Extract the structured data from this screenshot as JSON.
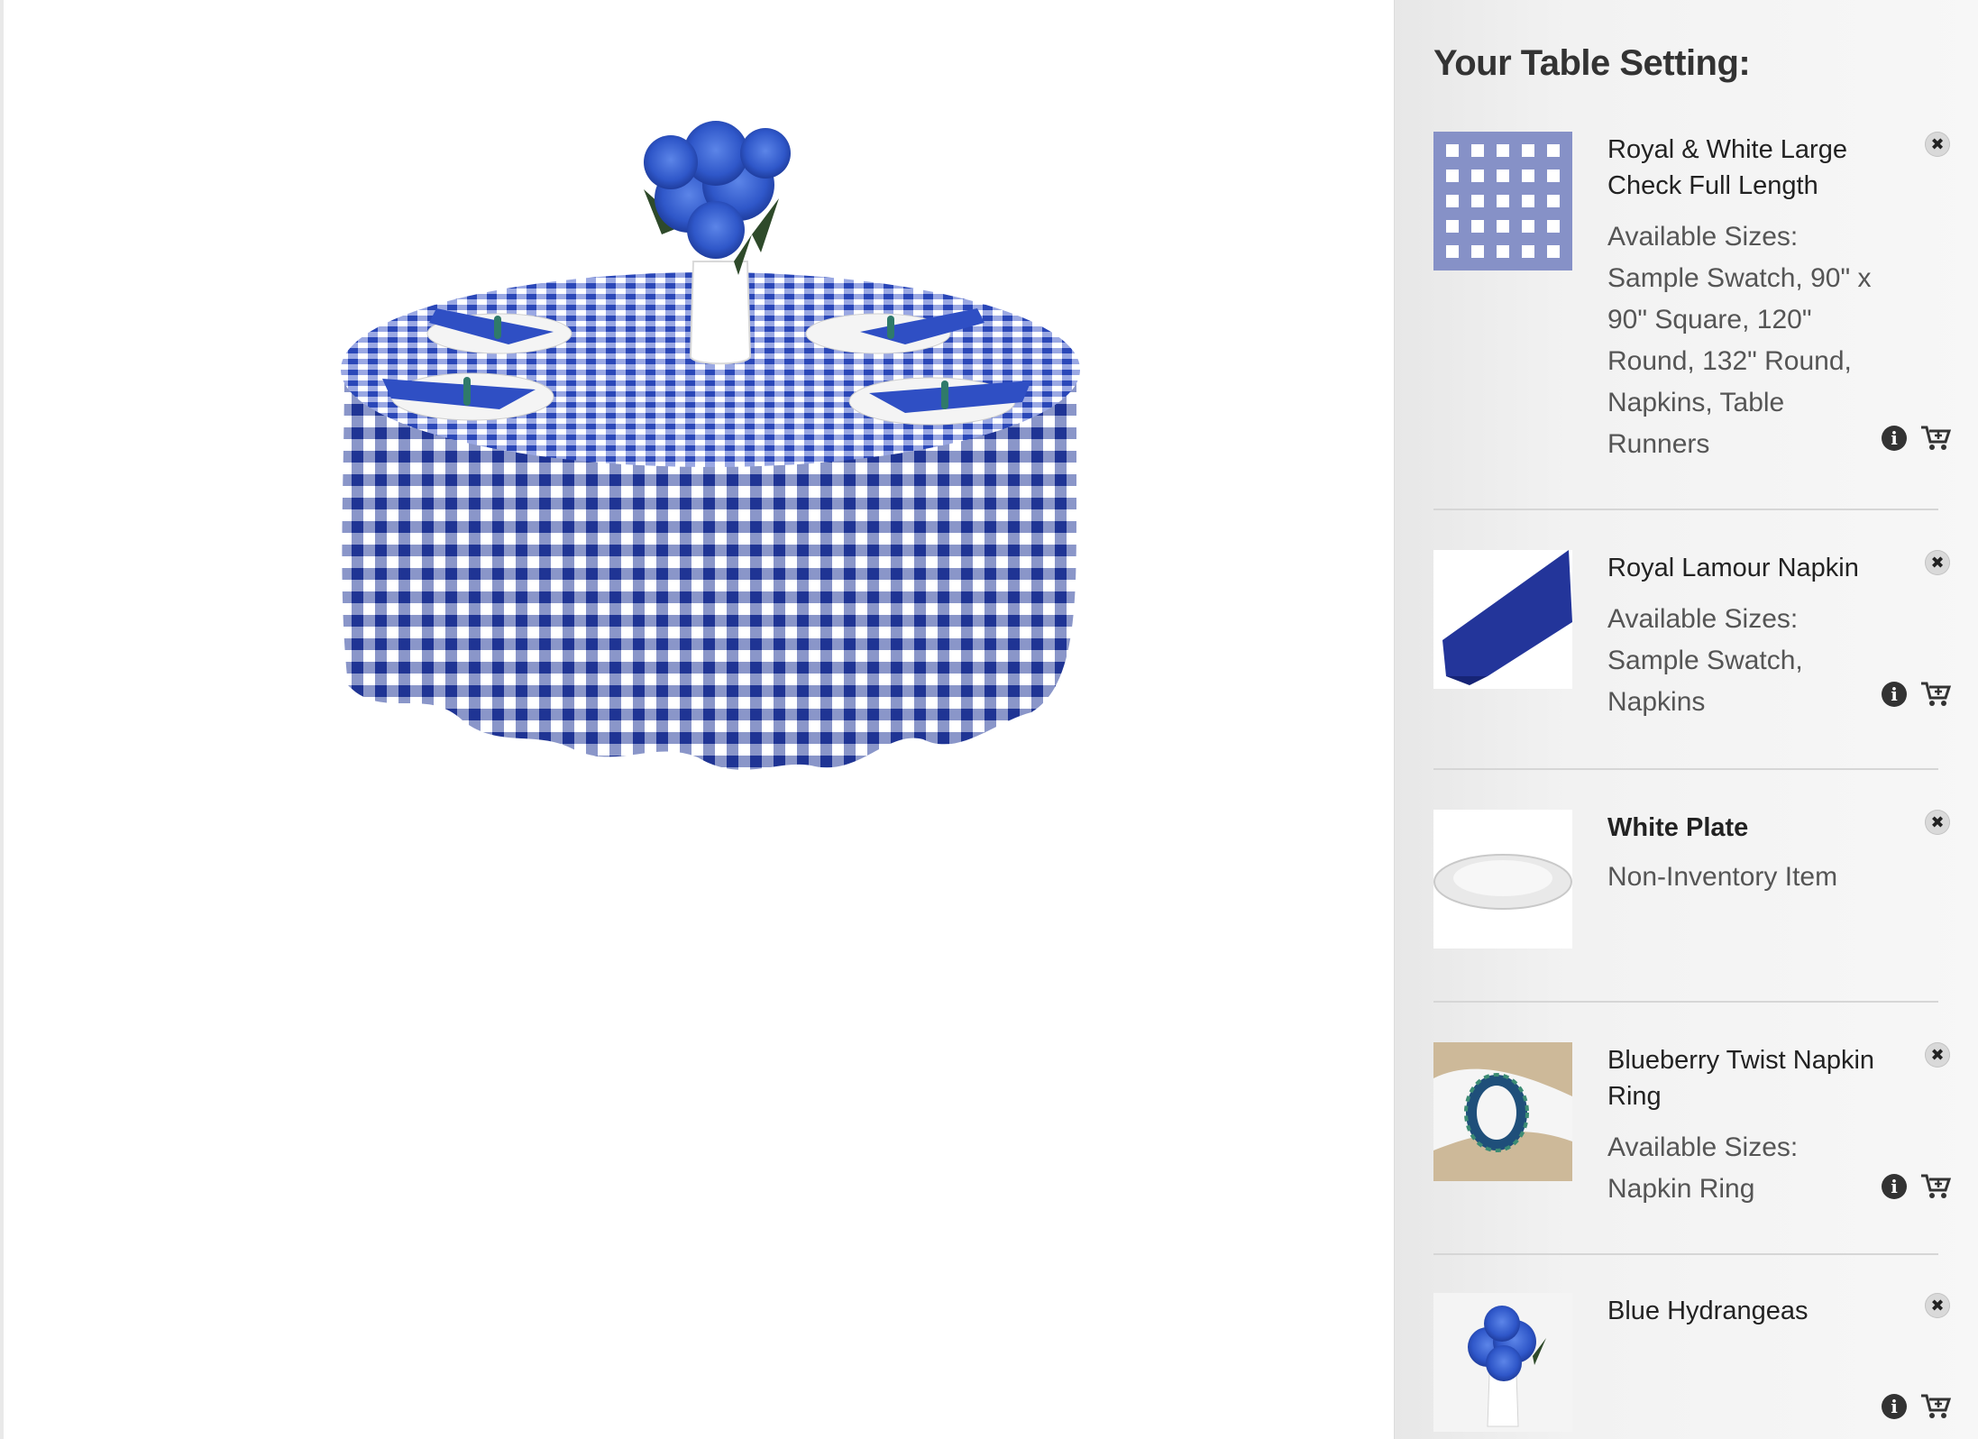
{
  "panel": {
    "title": "Your Table Setting:",
    "items": [
      {
        "name": "Royal & White Large Check Full Length",
        "sizes_label": "Available Sizes:",
        "sizes": "Sample Swatch, 90\" x 90\" Square, 120\" Round, 132\" Round, Napkins, Table Runners",
        "icons": [
          "close-icon",
          "info-icon",
          "cart-icon"
        ]
      },
      {
        "name": "Royal Lamour Napkin",
        "sizes_label": "Available Sizes:",
        "sizes": "Sample Swatch, Napkins",
        "icons": [
          "close-icon",
          "info-icon",
          "cart-icon"
        ]
      },
      {
        "name": "White Plate",
        "note": "Non-Inventory Item",
        "icons": [
          "close-icon"
        ]
      },
      {
        "name": "Blueberry Twist Napkin Ring",
        "sizes_label": "Available Sizes:",
        "sizes": "Napkin Ring",
        "icons": [
          "close-icon",
          "info-icon",
          "cart-icon"
        ]
      },
      {
        "name": "Blue Hydrangeas",
        "icons": [
          "close-icon",
          "info-icon",
          "cart-icon"
        ]
      }
    ]
  },
  "colors": {
    "royal_blue": "#2a3f9c",
    "napkin_blue": "#2f4fc4",
    "panel_bg": "#f2f2f2",
    "text_dark": "#222222",
    "text_muted": "#555555"
  }
}
